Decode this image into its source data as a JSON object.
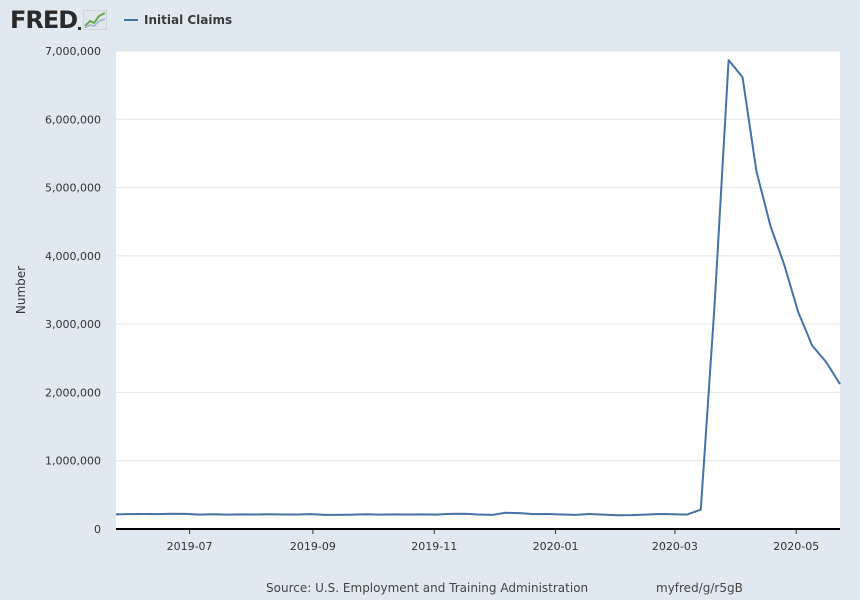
{
  "logo": {
    "text": "FRED",
    "icon": "fred-graph-icon"
  },
  "legend": {
    "label": "Initial Claims",
    "color": "#4572a7"
  },
  "footer": {
    "source": "Source: U.S. Employment and Training Administration",
    "url": "myfred/g/r5gB"
  },
  "chart_data": {
    "type": "line",
    "title": "",
    "xlabel": "",
    "ylabel": "Number",
    "ylim": [
      0,
      7000000
    ],
    "y_ticks": [
      0,
      1000000,
      2000000,
      3000000,
      4000000,
      5000000,
      6000000,
      7000000
    ],
    "y_tick_labels": [
      "0",
      "1,000,000",
      "2,000,000",
      "3,000,000",
      "4,000,000",
      "5,000,000",
      "6,000,000",
      "7,000,000"
    ],
    "xlim": [
      "2019-05-25",
      "2020-05-23"
    ],
    "x_ticks": [
      "2019-07-01",
      "2019-09-01",
      "2019-11-01",
      "2020-01-01",
      "2020-03-01",
      "2020-05-01"
    ],
    "x_tick_labels": [
      "2019-07",
      "2019-09",
      "2019-11",
      "2020-01",
      "2020-03",
      "2020-05"
    ],
    "grid": true,
    "line_color": "#4572a7",
    "series": [
      {
        "name": "Initial Claims",
        "x": [
          "2019-05-25",
          "2019-06-01",
          "2019-06-08",
          "2019-06-15",
          "2019-06-22",
          "2019-06-29",
          "2019-07-06",
          "2019-07-13",
          "2019-07-20",
          "2019-07-27",
          "2019-08-03",
          "2019-08-10",
          "2019-08-17",
          "2019-08-24",
          "2019-08-31",
          "2019-09-07",
          "2019-09-14",
          "2019-09-21",
          "2019-09-28",
          "2019-10-05",
          "2019-10-12",
          "2019-10-19",
          "2019-10-26",
          "2019-11-02",
          "2019-11-09",
          "2019-11-16",
          "2019-11-23",
          "2019-11-30",
          "2019-12-07",
          "2019-12-14",
          "2019-12-21",
          "2019-12-28",
          "2020-01-04",
          "2020-01-11",
          "2020-01-18",
          "2020-01-25",
          "2020-02-01",
          "2020-02-08",
          "2020-02-15",
          "2020-02-22",
          "2020-02-29",
          "2020-03-07",
          "2020-03-14",
          "2020-03-21",
          "2020-03-28",
          "2020-04-04",
          "2020-04-11",
          "2020-04-18",
          "2020-04-25",
          "2020-05-02",
          "2020-05-09",
          "2020-05-16",
          "2020-05-23"
        ],
        "values": [
          215000,
          218000,
          219000,
          217000,
          223000,
          221000,
          210000,
          216000,
          210000,
          214000,
          212000,
          216000,
          212000,
          213000,
          217000,
          206000,
          207000,
          211000,
          216000,
          211000,
          214000,
          212000,
          215000,
          211000,
          221000,
          224000,
          212000,
          206000,
          238000,
          232000,
          218000,
          219000,
          212000,
          207000,
          219000,
          211000,
          201000,
          203000,
          211000,
          219000,
          216000,
          211000,
          282000,
          3307000,
          6867000,
          6615000,
          5237000,
          4442000,
          3867000,
          3176000,
          2687000,
          2446000,
          2123000
        ]
      }
    ]
  }
}
